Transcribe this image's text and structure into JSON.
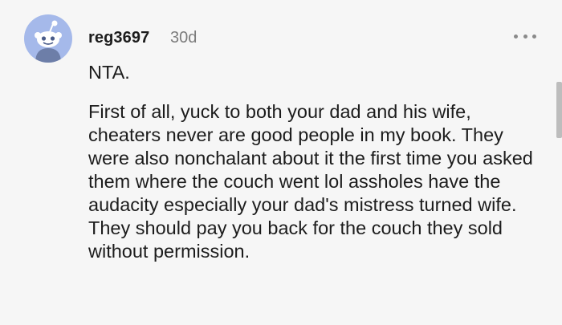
{
  "comment": {
    "username": "reg3697",
    "age": "30d",
    "avatar_icon": "reddit-snoo-icon",
    "more_icon": "more-options-icon",
    "paragraphs": [
      "NTA.",
      "First of all, yuck to both your dad and his wife, cheaters never are good people in my book. They were also nonchalant about it the first time you asked them where the couch went lol assholes have the audacity especially your dad's mistress turned wife. They should pay you back for the couch they sold without permission."
    ]
  },
  "colors": {
    "background": "#f6f6f6",
    "avatar_bg": "#a5b9ea",
    "meta_text": "#7c7c7c",
    "body_text": "#1c1c1c"
  }
}
